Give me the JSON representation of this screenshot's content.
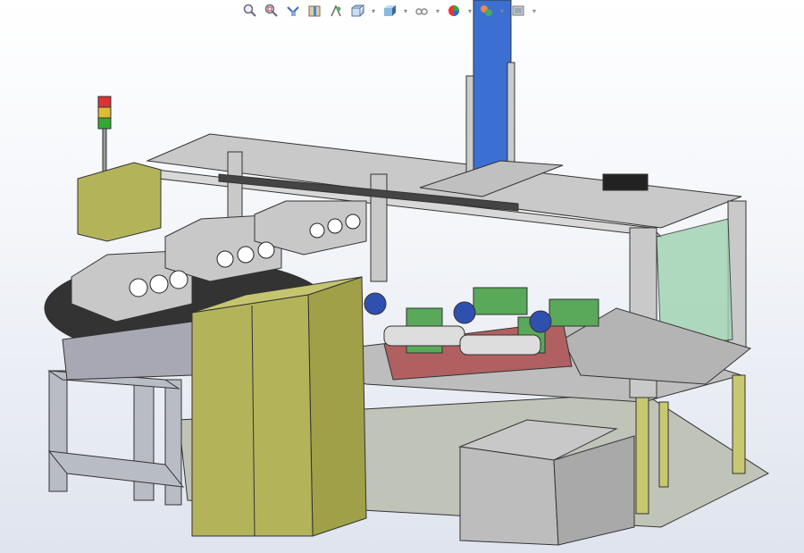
{
  "heads_up_toolbar": {
    "tools": [
      {
        "icon": "zoom-to-fit-icon",
        "dropdown": false
      },
      {
        "icon": "zoom-to-area-icon",
        "dropdown": false
      },
      {
        "icon": "previous-view-icon",
        "dropdown": false
      },
      {
        "icon": "section-view-icon",
        "dropdown": false
      },
      {
        "icon": "dynamic-annotation-views-icon",
        "dropdown": false
      },
      {
        "icon": "view-orientation-icon",
        "dropdown": true
      },
      {
        "icon": "display-style-icon",
        "dropdown": true
      },
      {
        "icon": "hide-show-items-icon",
        "dropdown": true
      },
      {
        "icon": "edit-appearance-icon",
        "dropdown": true
      },
      {
        "icon": "apply-scene-icon",
        "dropdown": true
      },
      {
        "icon": "view-settings-icon",
        "dropdown": true
      }
    ]
  },
  "colors": {
    "frame": "#c8c8c8",
    "cabinet": "#b3b35a",
    "column": "#3b6fd1",
    "guard": "#9fd3b0",
    "fixture": "#5aa85a",
    "base_plate": "#b06060"
  }
}
